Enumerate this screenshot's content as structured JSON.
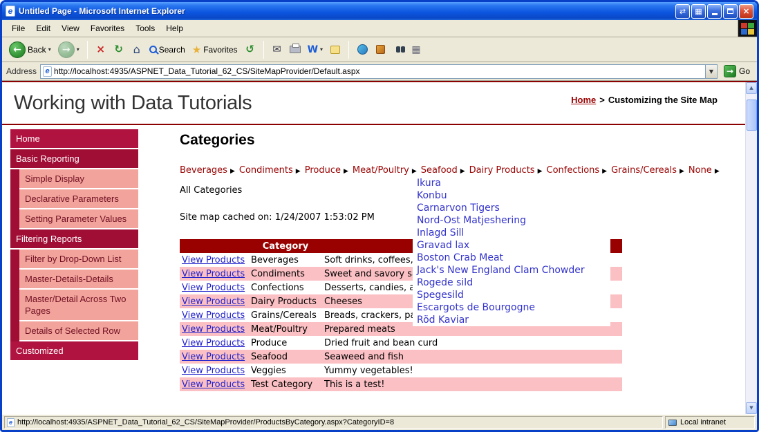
{
  "window": {
    "title": "Untitled Page - Microsoft Internet Explorer",
    "controls": {
      "extra1_glyph": "⇄",
      "extra2_glyph": "▦",
      "close_glyph": "×"
    }
  },
  "icons": {
    "ie_e": "e"
  },
  "menubar": {
    "items": [
      "File",
      "Edit",
      "View",
      "Favorites",
      "Tools",
      "Help"
    ]
  },
  "toolbar": {
    "back_label": "Back",
    "search_label": "Search",
    "favorites_label": "Favorites",
    "glyphs": {
      "back": "←",
      "forward": "→",
      "stop": "×",
      "refresh": "↻",
      "home": "⌂",
      "favorites": "★",
      "history": "↺",
      "mail": "✉",
      "edit": "W",
      "grid": "▦",
      "caret": "▾",
      "go": "→",
      "scroll_up": "▲",
      "scroll_down": "▼"
    }
  },
  "addressbar": {
    "label": "Address",
    "url": "http://localhost:4935/ASPNET_Data_Tutorial_62_CS/SiteMapProvider/Default.aspx",
    "go_label": "Go"
  },
  "page": {
    "header": {
      "title": "Working with Data Tutorials",
      "breadcrumb": {
        "home": "Home",
        "separator": ">",
        "current": "Customizing the Site Map"
      }
    },
    "sidebar": {
      "items": [
        {
          "label": "Home",
          "type": "top"
        },
        {
          "label": "Basic Reporting",
          "type": "section"
        },
        {
          "label": "Simple Display",
          "type": "sub"
        },
        {
          "label": "Declarative Parameters",
          "type": "sub"
        },
        {
          "label": "Setting Parameter Values",
          "type": "sub"
        },
        {
          "label": "Filtering Reports",
          "type": "section"
        },
        {
          "label": "Filter by Drop-Down List",
          "type": "sub"
        },
        {
          "label": "Master-Details-Details",
          "type": "sub"
        },
        {
          "label": "Master/Detail Across Two Pages",
          "type": "sub"
        },
        {
          "label": "Details of Selected Row",
          "type": "sub"
        },
        {
          "label": "Customized",
          "type": "section"
        }
      ]
    },
    "main": {
      "heading": "Categories",
      "menu": {
        "arrow_glyph": "▶",
        "items": [
          "Beverages",
          "Condiments",
          "Produce",
          "Meat/Poultry",
          "Seafood",
          "Dairy Products",
          "Confections",
          "Grains/Cereals",
          "None"
        ]
      },
      "submenu": {
        "items": [
          "Ikura",
          "Konbu",
          "Carnarvon Tigers",
          "Nord-Ost Matjeshering",
          "Inlagd Sill",
          "Gravad lax",
          "Boston Crab Meat",
          "Jack's New England Clam Chowder",
          "Rogede sild",
          "Spegesild",
          "Escargots de Bourgogne",
          "Röd Kaviar"
        ]
      },
      "all_categories": "All Categories",
      "cache_note": "Site map cached on: 1/24/2007 1:53:02 PM",
      "table": {
        "headers": [
          "",
          "Category",
          ""
        ],
        "link_label": "View Products",
        "rows": [
          {
            "category": "Beverages",
            "description": "Soft drinks, coffees, teas, beers, and ales"
          },
          {
            "category": "Condiments",
            "description": "Sweet and savory sauces, relishes, spreads, and seasonings"
          },
          {
            "category": "Confections",
            "description": "Desserts, candies, and sweet breads"
          },
          {
            "category": "Dairy Products",
            "description": "Cheeses"
          },
          {
            "category": "Grains/Cereals",
            "description": "Breads, crackers, pasta, and cereal"
          },
          {
            "category": "Meat/Poultry",
            "description": "Prepared meats"
          },
          {
            "category": "Produce",
            "description": "Dried fruit and bean curd"
          },
          {
            "category": "Seafood",
            "description": "Seaweed and fish"
          },
          {
            "category": "Veggies",
            "description": "Yummy vegetables!"
          },
          {
            "category": "Test Category",
            "description": "This is a test!"
          }
        ]
      }
    }
  },
  "statusbar": {
    "status_url": "http://localhost:4935/ASPNET_Data_Tutorial_62_CS/SiteMapProvider/ProductsByCategory.aspx?CategoryID=8",
    "zone": "Local intranet"
  },
  "colors": {
    "maroon_rule": "#8B0000",
    "table_header": "#990000",
    "table_alt_row": "#FBC0C4",
    "sidebar_section": "#A00D35",
    "sidebar_top": "#B01340",
    "sidebar_sub": "#F2A39C",
    "menu_link": "#990000",
    "submenu_link": "#3333CC",
    "view_products_link": "#2222CC"
  }
}
